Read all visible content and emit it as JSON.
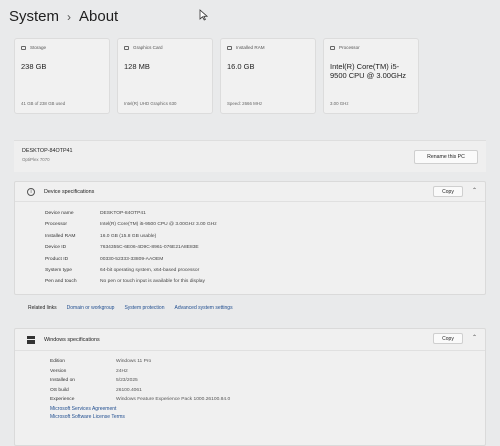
{
  "header": {
    "section": "System",
    "separator": "›",
    "page": "About"
  },
  "tiles": [
    {
      "icon": "storage-icon",
      "title": "Storage",
      "value": "238 GB",
      "sub": "41 GB of 238 GB used"
    },
    {
      "icon": "graphics-card-icon",
      "title": "Graphics Card",
      "value": "128 MB",
      "sub": "Intel(R) UHD Graphics 630"
    },
    {
      "icon": "ram-icon",
      "title": "Installed RAM",
      "value": "16.0 GB",
      "sub": "Speed: 2666 MHz"
    },
    {
      "icon": "processor-icon",
      "title": "Processor",
      "value": "Intel(R) Core(TM) i5-9500 CPU @ 3.00GHz",
      "sub": "3.00 GHz"
    }
  ],
  "device": {
    "name": "DESKTOP-84OTP41",
    "model": "OptiPlex 7070",
    "rename_label": "Rename this PC"
  },
  "device_specs": {
    "title": "Device specifications",
    "copy_label": "Copy",
    "rows": [
      {
        "label": "Device name",
        "value": "DESKTOP-84OTP41"
      },
      {
        "label": "Processor",
        "value": "Intel(R) Core(TM) i5-9500 CPU @ 3.00GHz   3.00 GHz"
      },
      {
        "label": "Installed RAM",
        "value": "16.0 GB (15.8 GB usable)"
      },
      {
        "label": "Device ID",
        "value": "7634355C-6E06-4D9C-8961-076E21A8E83E"
      },
      {
        "label": "Product ID",
        "value": "00330-52333-33809-AAOEM"
      },
      {
        "label": "System type",
        "value": "64-bit operating system, x64-based processor"
      },
      {
        "label": "Pen and touch",
        "value": "No pen or touch input is available for this display"
      }
    ]
  },
  "related": {
    "label": "Related links",
    "links": [
      "Domain or workgroup",
      "System protection",
      "Advanced system settings"
    ]
  },
  "windows_specs": {
    "title": "Windows specifications",
    "copy_label": "Copy",
    "rows": [
      {
        "label": "Edition",
        "value": "Windows 11 Pro"
      },
      {
        "label": "Version",
        "value": "24H2"
      },
      {
        "label": "Installed on",
        "value": "5/23/2025"
      },
      {
        "label": "OS build",
        "value": "26100.4061"
      },
      {
        "label": "Experience",
        "value": "Windows Feature Experience Pack 1000.26100.84.0"
      }
    ],
    "links": [
      "Microsoft Services Agreement",
      "Microsoft Software License Terms"
    ]
  }
}
